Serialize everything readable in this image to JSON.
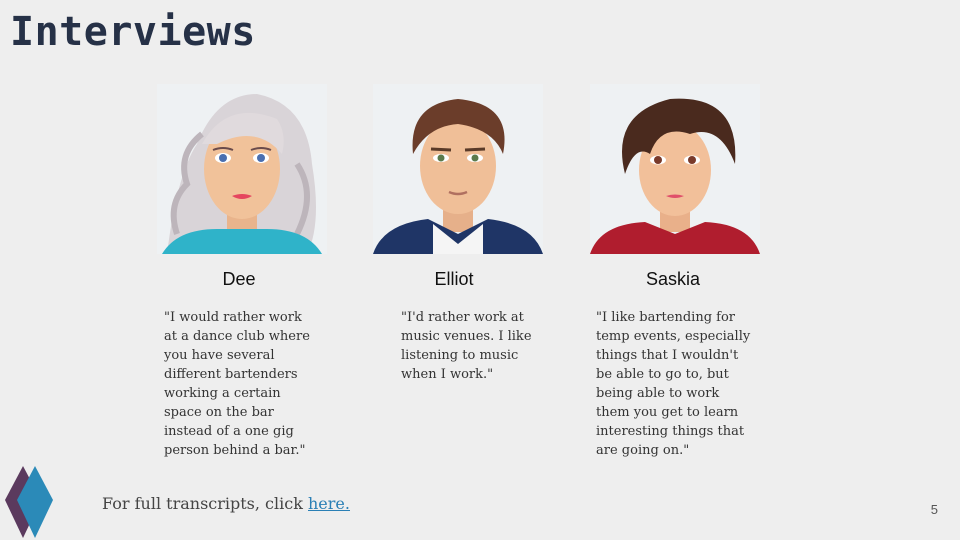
{
  "slide": {
    "title": "Interviews",
    "page_number": "5"
  },
  "interviewees": [
    {
      "name": "Dee",
      "quote": "\"I would rather work\nat a dance club where\nyou have several\ndifferent bartenders\nworking a certain\nspace on the bar\ninstead of a one gig\nperson behind a bar.\"",
      "avatar_icon": "woman-avatar-icon"
    },
    {
      "name": "Elliot",
      "quote": "\"I'd rather work at\nmusic venues. I like\nlistening to music\nwhen I work.\"",
      "avatar_icon": "man-avatar-icon"
    },
    {
      "name": "Saskia",
      "quote": "\"I like bartending for\ntemp events, especially\nthings that I wouldn't\nbe able to go to, but\nbeing able to work\nthem you get to learn\ninteresting things that\nare going on.\"",
      "avatar_icon": "woman-avatar-icon"
    }
  ],
  "footer": {
    "text": "For full transcripts, click ",
    "link_text": "here."
  },
  "colors": {
    "title": "#263147",
    "link": "#2a7fb5",
    "logo_dark": "#5b3a5e",
    "logo_light": "#2b8ab8"
  }
}
